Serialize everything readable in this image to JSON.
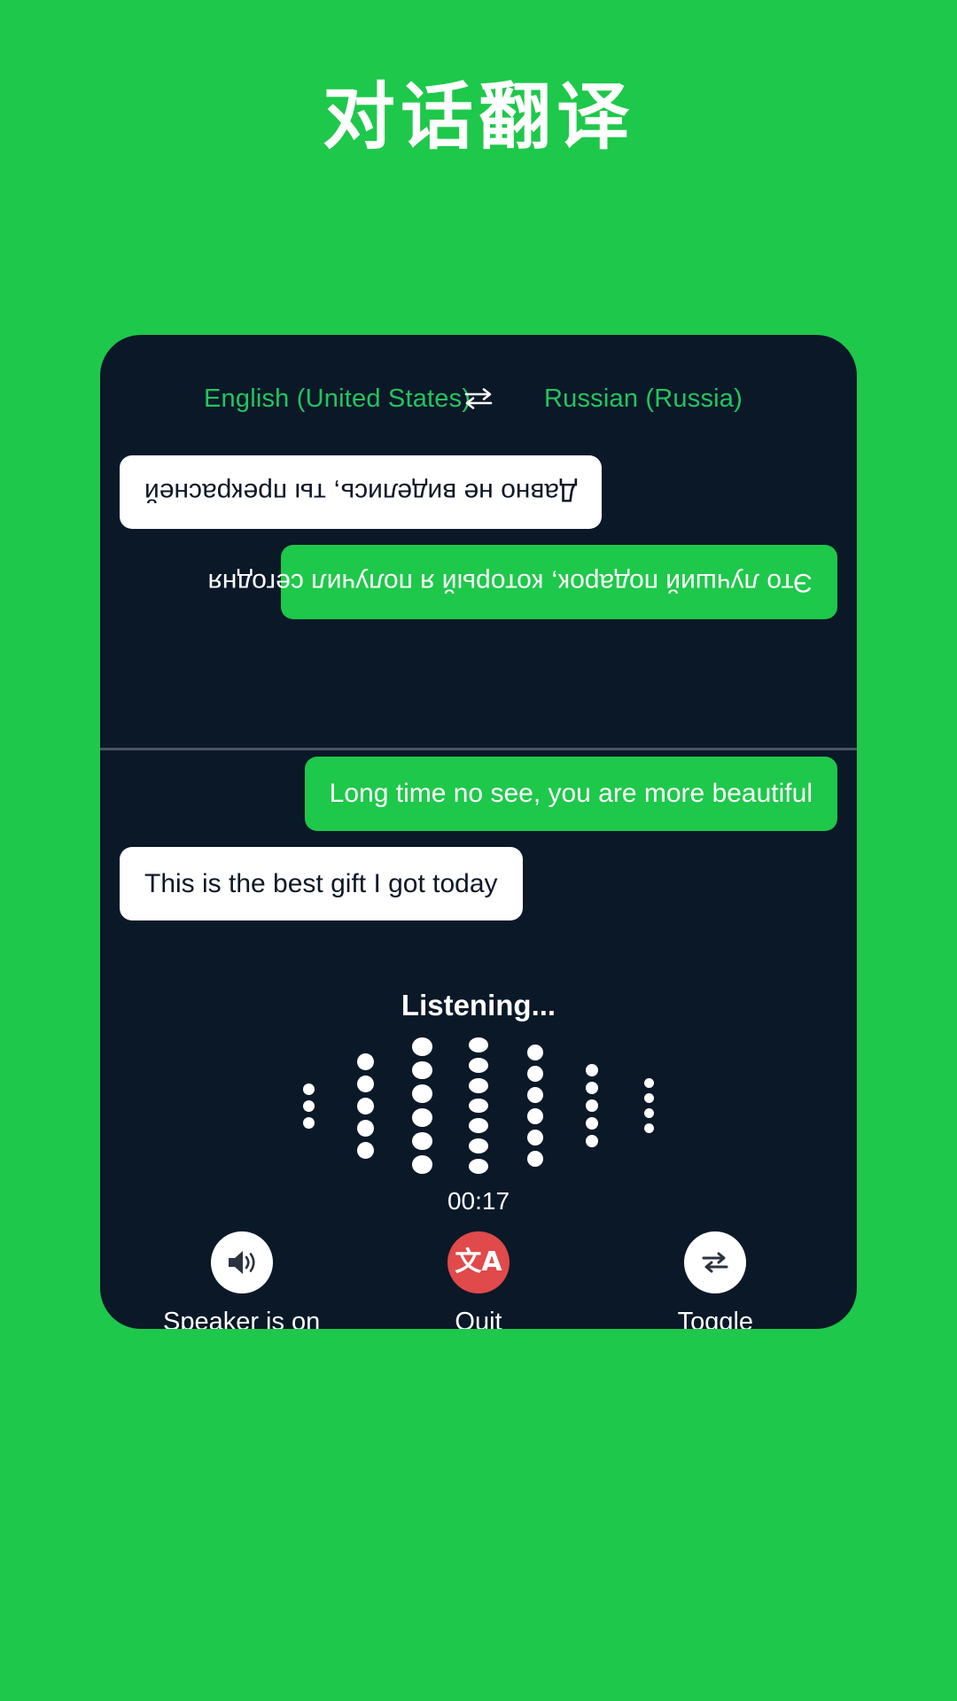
{
  "page": {
    "title": "对话翻译",
    "background_color": "#1ec84a",
    "card_color": "#0a1828"
  },
  "language_bar": {
    "source_language": "English (United States)",
    "swap_icon": "swap-horizontal-icon",
    "target_language": "Russian (Russia)",
    "text_color": "#22c55e"
  },
  "conversation": {
    "top_pane_rotated": true,
    "top_messages": [
      {
        "text": "Это лучший подарок, который я получил сегодня",
        "style": "green",
        "align": "left"
      },
      {
        "text": "Давно не виделись, ты прекрасней",
        "style": "white",
        "align": "right"
      }
    ],
    "bottom_messages": [
      {
        "text": "Long time no see, you are more beautiful",
        "style": "green",
        "align": "right"
      },
      {
        "text": "This is the best gift I got today",
        "style": "white",
        "align": "left"
      }
    ]
  },
  "status": {
    "listening_label": "Listening...",
    "timer": "00:17"
  },
  "waveform": {
    "dot_color": "#ffffff",
    "columns": [
      {
        "count": 3,
        "size": 13
      },
      {
        "count": 5,
        "size": 19
      },
      {
        "count": 6,
        "size": 23
      },
      {
        "count": 7,
        "size": 22
      },
      {
        "count": 6,
        "size": 18
      },
      {
        "count": 5,
        "size": 14
      },
      {
        "count": 4,
        "size": 11
      }
    ]
  },
  "controls": [
    {
      "label": "Speaker is on",
      "icon": "speaker-on-icon",
      "style": "light"
    },
    {
      "label": "Quit",
      "icon": "translate-icon",
      "style": "danger",
      "glyph": "文A",
      "color": "#e04a4a"
    },
    {
      "label": "Toggle",
      "icon": "swap-repeat-icon",
      "style": "light"
    }
  ]
}
